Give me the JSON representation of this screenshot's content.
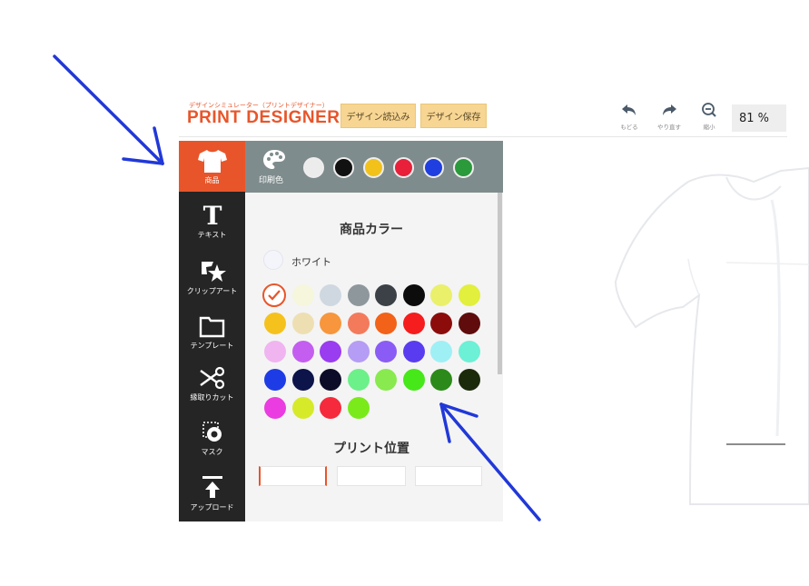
{
  "header": {
    "tagline": "デザインシミュレーター（プリントデザイナー）",
    "logo": "PRINT DESIGNER",
    "buttons": {
      "load": "デザイン読込み",
      "save": "デザイン保存"
    },
    "tools": {
      "undo": "もどる",
      "redo": "やり直す",
      "zoom_out": "縮小"
    },
    "zoom": "81 %"
  },
  "sidebar": {
    "items": [
      {
        "label": "商品",
        "icon": "tshirt-icon",
        "active": true
      },
      {
        "label": "テキスト",
        "icon": "text-icon"
      },
      {
        "label": "クリップアート",
        "icon": "clipart-icon"
      },
      {
        "label": "テンプレート",
        "icon": "folder-icon"
      },
      {
        "label": "縁取りカット",
        "icon": "scissors-icon"
      },
      {
        "label": "マスク",
        "icon": "mask-icon"
      },
      {
        "label": "アップロード",
        "icon": "upload-icon"
      }
    ]
  },
  "print_colors": {
    "label": "印刷色",
    "icon": "palette-icon",
    "colors": [
      "#ececec",
      "#111111",
      "#f2c21b",
      "#e8203a",
      "#1f3fe0",
      "#2a9a3a"
    ]
  },
  "product_panel": {
    "title": "商品カラー",
    "selected_color_name": "ホワイト",
    "selected_color": "#f4f4fb",
    "swatches": [
      [
        "#ffffff",
        "#f6f6dc",
        "#cfd8e0",
        "#8e979c",
        "#3c4148",
        "#0c0c0c",
        "#eaf06a",
        "#e2ef3c"
      ],
      [
        "#f5c21d",
        "#eedfb2",
        "#f7963c",
        "#f47a5c",
        "#f26218",
        "#f51d1d",
        "#8c0c0c",
        "#600c0c"
      ],
      [
        "#f0b4f0",
        "#c45ef0",
        "#9a3cf0",
        "#b59cf5",
        "#8a5cf5",
        "#5a3cf0",
        "#9ef0f5",
        "#6cf0d6"
      ],
      [
        "#1e3ce6",
        "#0c144a",
        "#0c0c28",
        "#6cf08a",
        "#88ea4e",
        "#46e81a",
        "#2c8a1a",
        "#1c2a0c"
      ],
      [
        "#ea3ce0",
        "#d6ea2a",
        "#f52a3c",
        "#7aea1a"
      ]
    ],
    "print_position_title": "プリント位置"
  },
  "colors": {
    "accent": "#e8552a",
    "sidebar_bg": "#252525",
    "print_bar_bg": "#7f8c8d",
    "annotation_arrow": "#2138d8"
  }
}
